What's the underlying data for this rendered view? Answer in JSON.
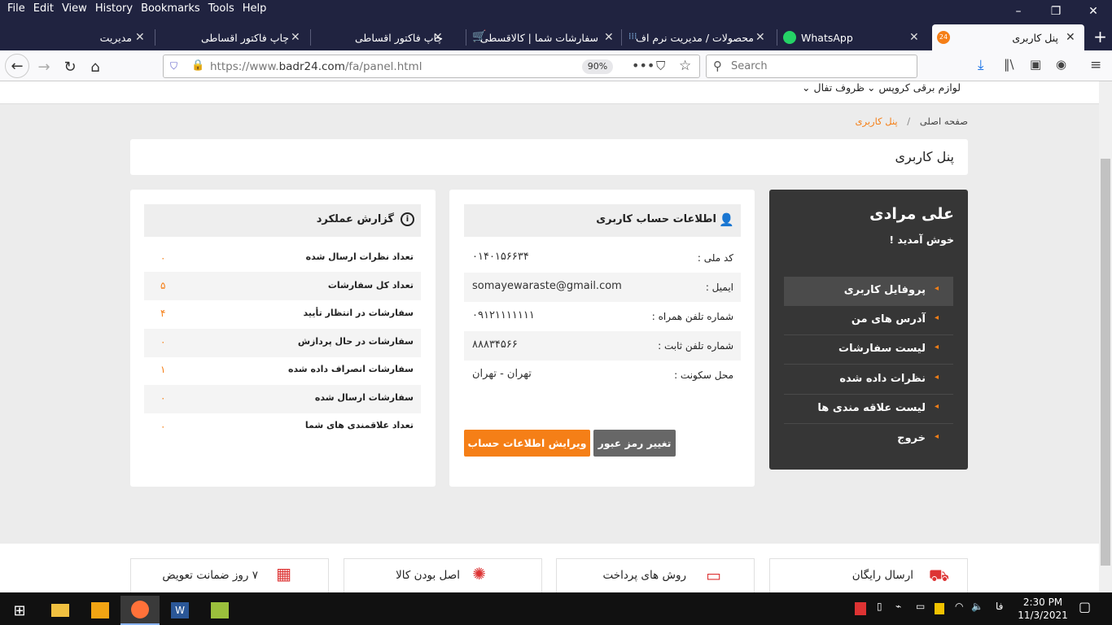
{
  "menu": [
    "File",
    "Edit",
    "View",
    "History",
    "Bookmarks",
    "Tools",
    "Help"
  ],
  "window_controls": {
    "minimize": "–",
    "maximize": "❐",
    "close": "✕"
  },
  "tabs": [
    {
      "title": "مدیریت"
    },
    {
      "title": "چاپ فاکتور اقساطی"
    },
    {
      "title": "چاپ فاکتور اقساطی"
    },
    {
      "title": "سفارشات شما | کالاقسطی"
    },
    {
      "title": "محصولات / مدیریت نرم اف"
    },
    {
      "title": "WhatsApp"
    },
    {
      "title": "پنل کاربری"
    }
  ],
  "new_tab": "+",
  "url": {
    "prefix": "https://www.",
    "host": "badr24.com",
    "path": "/fa/panel.html"
  },
  "zoom": "90%",
  "search_placeholder": "Search",
  "top_categories": [
    "لوازم برقی کروپس",
    "ظروف تفال"
  ],
  "breadcrumb": {
    "home": "صفحه اصلی",
    "sep": "/",
    "current": "پنل کاربری"
  },
  "page_title": "پنل کاربری",
  "sidebar": {
    "user_name": "علی مرادی",
    "welcome": "خوش آمدید !",
    "items": [
      {
        "label": "پروفایل کاربری"
      },
      {
        "label": "آدرس های من"
      },
      {
        "label": "لیست سفارشات"
      },
      {
        "label": "نظرات داده شده"
      },
      {
        "label": "لیست علاقه مندی ها"
      },
      {
        "label": "خروج"
      }
    ]
  },
  "account": {
    "heading": "اطلاعات حساب کاربری",
    "rows": [
      {
        "label": "کد ملی :",
        "value": "۰۱۴۰۱۵۶۶۳۴"
      },
      {
        "label": "ایمیل :",
        "value": "somayewaraste@gmail.com"
      },
      {
        "label": "شماره تلفن همراه :",
        "value": "۰۹۱۲۱۱۱۱۱۱۱"
      },
      {
        "label": "شماره تلفن ثابت :",
        "value": "۸۸۸۳۴۵۶۶"
      },
      {
        "label": "محل سکونت :",
        "value": "تهران - تهران"
      }
    ],
    "edit_button": "ویرایش اطلاعات حساب",
    "password_button": "تغییر رمز عبور"
  },
  "performance": {
    "heading": "گزارش عملکرد",
    "rows": [
      {
        "label": "تعداد نظرات ارسال شده",
        "value": "۰"
      },
      {
        "label": "تعداد کل سفارشات",
        "value": "۵"
      },
      {
        "label": "سفارشات در انتظار تأیید",
        "value": "۴"
      },
      {
        "label": "سفارشات در حال پردازش",
        "value": "۰"
      },
      {
        "label": "سفارشات انصراف داده شده",
        "value": "۱"
      },
      {
        "label": "سفارشات ارسال شده",
        "value": "۰"
      },
      {
        "label": "تعداد علاقمندی های شما",
        "value": "۰"
      }
    ]
  },
  "features": [
    "ارسال رایگان",
    "روش های پرداخت",
    "اصل بودن کالا",
    "۷ روز ضمانت تعویض"
  ],
  "taskbar": {
    "time": "2:30 PM",
    "date": "11/3/2021",
    "lang": "فا"
  },
  "colors": {
    "accent": "#f57f17",
    "dark": "#363636",
    "titlebar": "#202340"
  }
}
